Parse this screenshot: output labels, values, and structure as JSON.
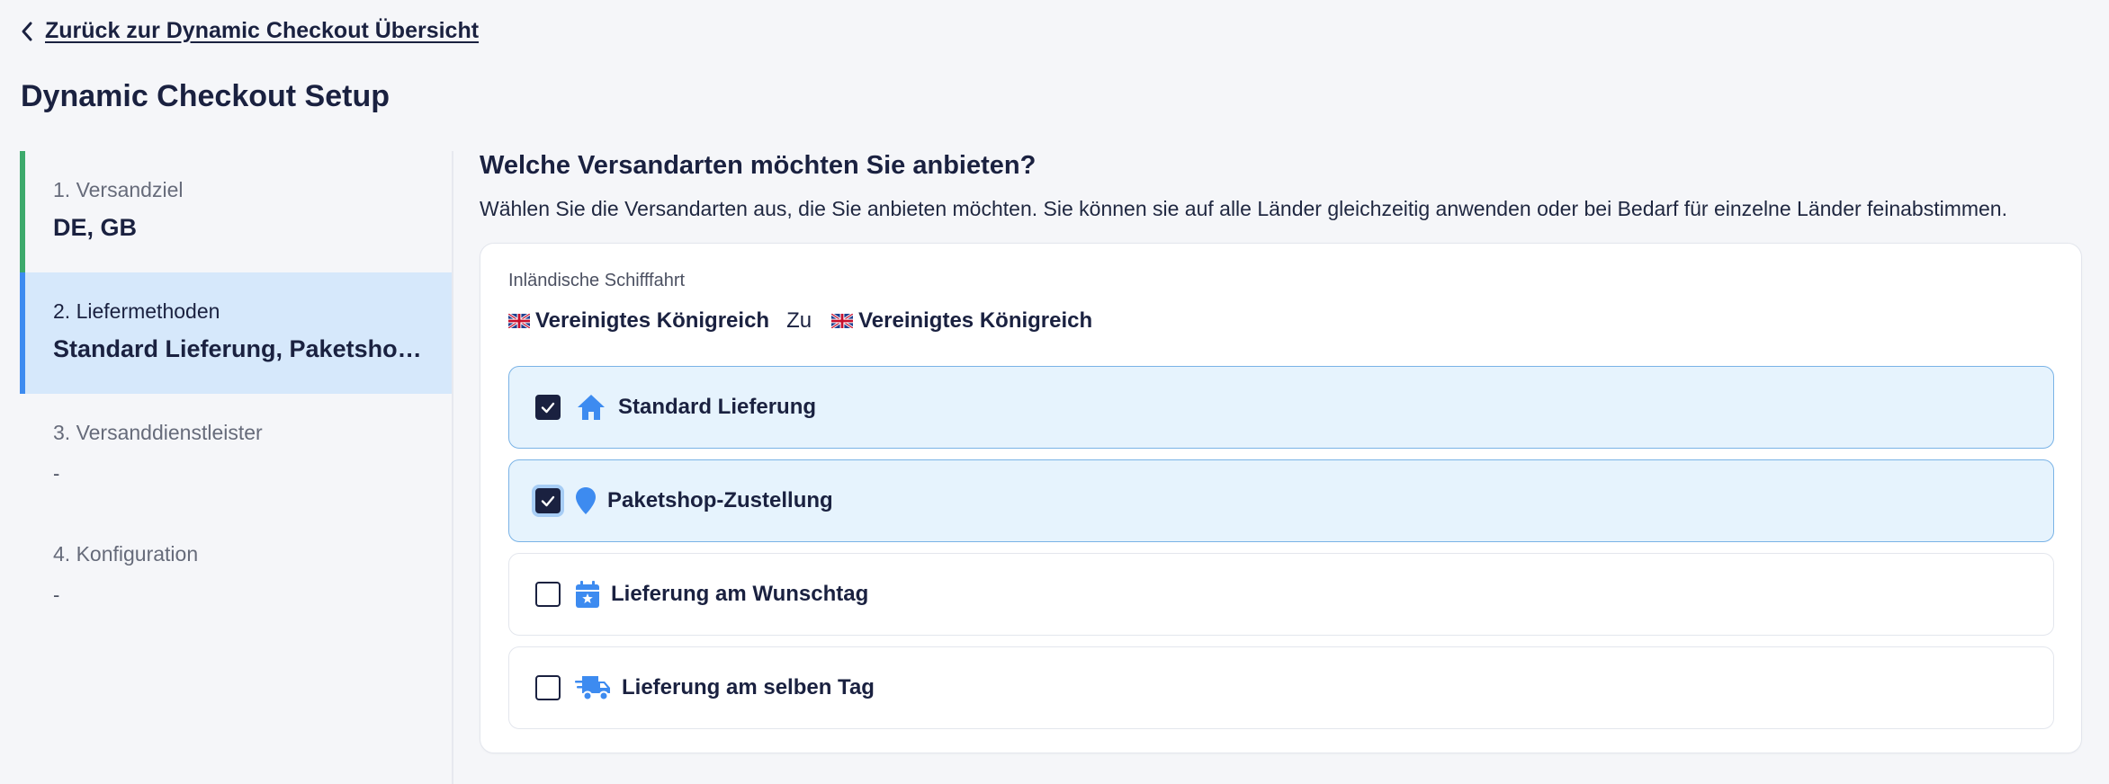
{
  "back_link": {
    "label": "Zurück zur Dynamic Checkout Übersicht"
  },
  "page_title": "Dynamic Checkout Setup",
  "steps": [
    {
      "title": "1. Versandziel",
      "value": "DE, GB",
      "state": "done"
    },
    {
      "title": "2. Liefermethoden",
      "value": "Standard Lieferung, Paketshop-Zustellung",
      "state": "active"
    },
    {
      "title": "3. Versanddienstleister",
      "value": "-",
      "state": "pending"
    },
    {
      "title": "4. Konfiguration",
      "value": "-",
      "state": "pending"
    }
  ],
  "main": {
    "heading": "Welche Versandarten möchten Sie anbieten?",
    "description": "Wählen Sie die Versandarten aus, die Sie anbieten möchten. Sie können sie auf alle Länder gleichzeitig anwenden oder bei Bedarf für einzelne Länder feinabstimmen.",
    "card": {
      "label": "Inländische Schifffahrt",
      "route": {
        "from": "Vereinigtes Königreich",
        "to_word": "Zu",
        "to": "Vereinigtes Königreich"
      },
      "options": [
        {
          "label": "Standard Lieferung",
          "checked": true,
          "icon": "house-icon"
        },
        {
          "label": "Paketshop-Zustellung",
          "checked": true,
          "icon": "location-pin-icon"
        },
        {
          "label": "Lieferung am Wunschtag",
          "checked": false,
          "icon": "calendar-star-icon"
        },
        {
          "label": "Lieferung am selben Tag",
          "checked": false,
          "icon": "fast-truck-icon"
        }
      ]
    }
  },
  "colors": {
    "accent": "#3d8bf0",
    "done": "#3daa6c",
    "active_bg": "#d6e8fb",
    "checked_bg": "#e6f3fd",
    "text": "#1a2140"
  }
}
